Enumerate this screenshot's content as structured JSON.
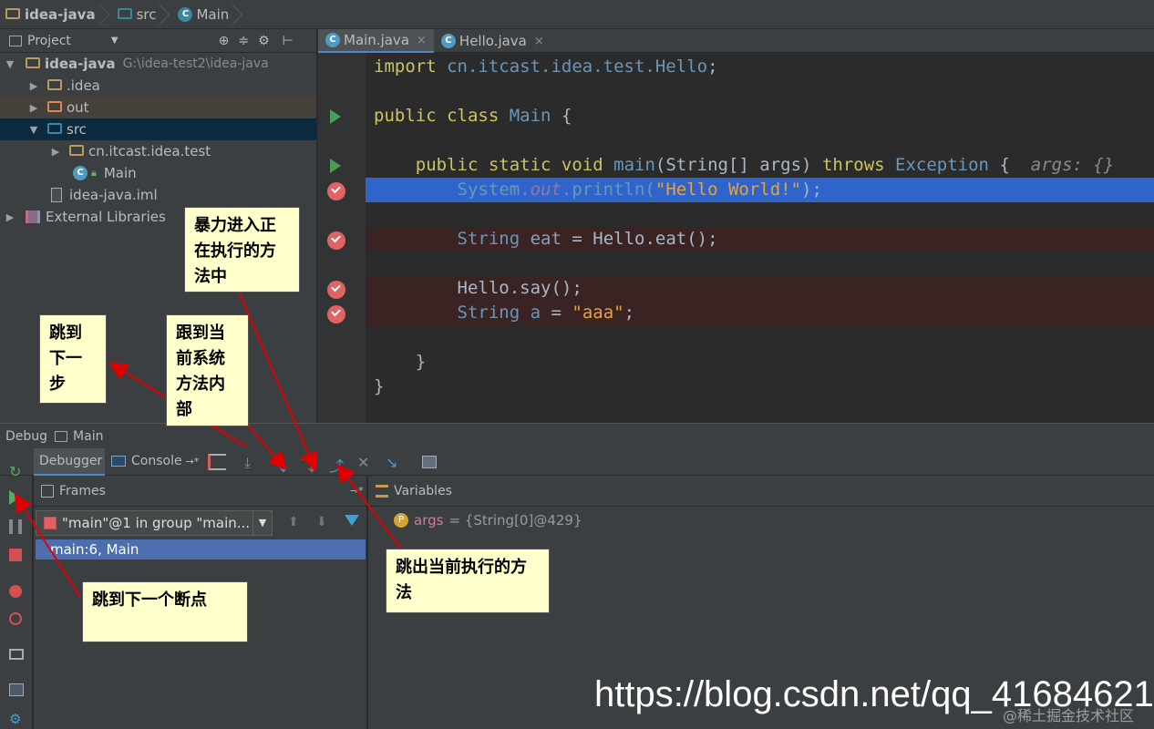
{
  "breadcrumb": {
    "project": "idea-java",
    "folder": "src",
    "file": "Main"
  },
  "project_panel": {
    "header": "Project",
    "root": {
      "label": "idea-java",
      "path": "G:\\idea-test2\\idea-java"
    },
    "items": [
      {
        "label": ".idea"
      },
      {
        "label": "out"
      },
      {
        "label": "src"
      },
      {
        "label": "cn.itcast.idea.test"
      },
      {
        "label": "Main"
      },
      {
        "label": "idea-java.iml"
      },
      {
        "label": "External Libraries"
      }
    ]
  },
  "tabs": [
    {
      "label": "Main.java",
      "close": "×"
    },
    {
      "label": "Hello.java",
      "close": "×"
    }
  ],
  "code": {
    "l1": {
      "kw": "import",
      "pkg": "cn.itcast.idea.test.Hello",
      "semi": ";"
    },
    "l3": {
      "kw": "public class",
      "name": "Main",
      "brace": "{"
    },
    "l5": {
      "kw": "public static void",
      "name": "main",
      "p1": "(String[] args)",
      "throws": "throws",
      "exc": "Exception",
      "brace": "{",
      "hint": "args: {}"
    },
    "l6": {
      "a": "System.",
      "out": "out",
      "b": ".println(",
      "s": "\"Hello World!\"",
      "c": ");"
    },
    "l8": {
      "a": "String",
      "var": "eat",
      "b": "= Hello.eat();"
    },
    "l10": {
      "a": "Hello.say();"
    },
    "l11": {
      "a": "String",
      "var": "a",
      "eq": "=",
      "s": "\"aaa\"",
      "c": ";"
    },
    "l13": {
      "a": "}"
    },
    "l14": {
      "a": "}"
    }
  },
  "debug": {
    "title": "Debug",
    "config": "Main",
    "tab_debugger": "Debugger",
    "tab_console": "Console",
    "console_suffix": "→*",
    "frames_label": "Frames",
    "variables_label": "Variables",
    "thread": "\"main\"@1 in group \"main...",
    "frame": "main:6, Main",
    "var_name": "args",
    "var_value": "= {String[0]@429}",
    "var_badge": "P"
  },
  "annotations": {
    "force_step_into": "暴力进入正在执行的方法中",
    "step_over": "跳到下一步",
    "step_into": "跟到当前系统方法内部",
    "step_out": "跳出当前执行的方法",
    "resume": "跳到下一个断点"
  },
  "watermark": "https://blog.csdn.net/qq_41684621",
  "watermark2": "@稀土掘金技术社区",
  "colors": {
    "accent": "#4a88c7",
    "selection": "#2f65ca",
    "note_bg": "#ffffcc",
    "arrow": "#e00000"
  }
}
